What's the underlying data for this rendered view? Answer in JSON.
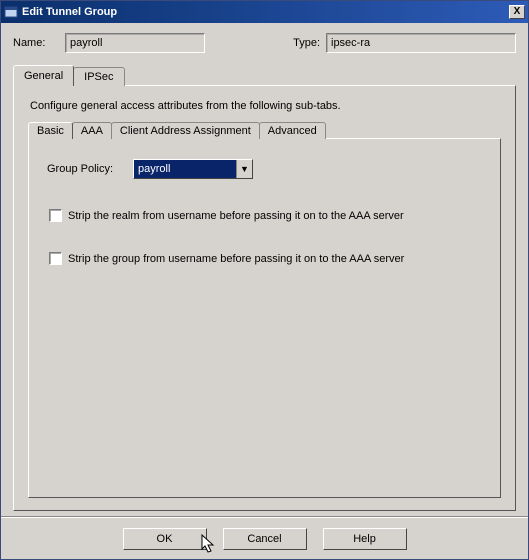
{
  "window": {
    "title": "Edit Tunnel Group"
  },
  "fields": {
    "name_label": "Name:",
    "name_value": "payroll",
    "type_label": "Type:",
    "type_value": "ipsec-ra"
  },
  "outer_tabs": {
    "general": "General",
    "ipsec": "IPSec"
  },
  "panel": {
    "description": "Configure general access attributes from the following sub-tabs.",
    "inner_tabs": {
      "basic": "Basic",
      "aaa": "AAA",
      "client_addr": "Client Address Assignment",
      "advanced": "Advanced"
    },
    "group_policy_label": "Group Policy:",
    "group_policy_value": "payroll",
    "strip_realm_label": "Strip the realm from username before passing it on to the AAA server",
    "strip_group_label": "Strip the group from username before passing it on to the AAA server"
  },
  "buttons": {
    "ok": "OK",
    "cancel": "Cancel",
    "help": "Help"
  },
  "icons": {
    "app": "app-icon",
    "close": "X",
    "combo_arrow": "▼"
  }
}
